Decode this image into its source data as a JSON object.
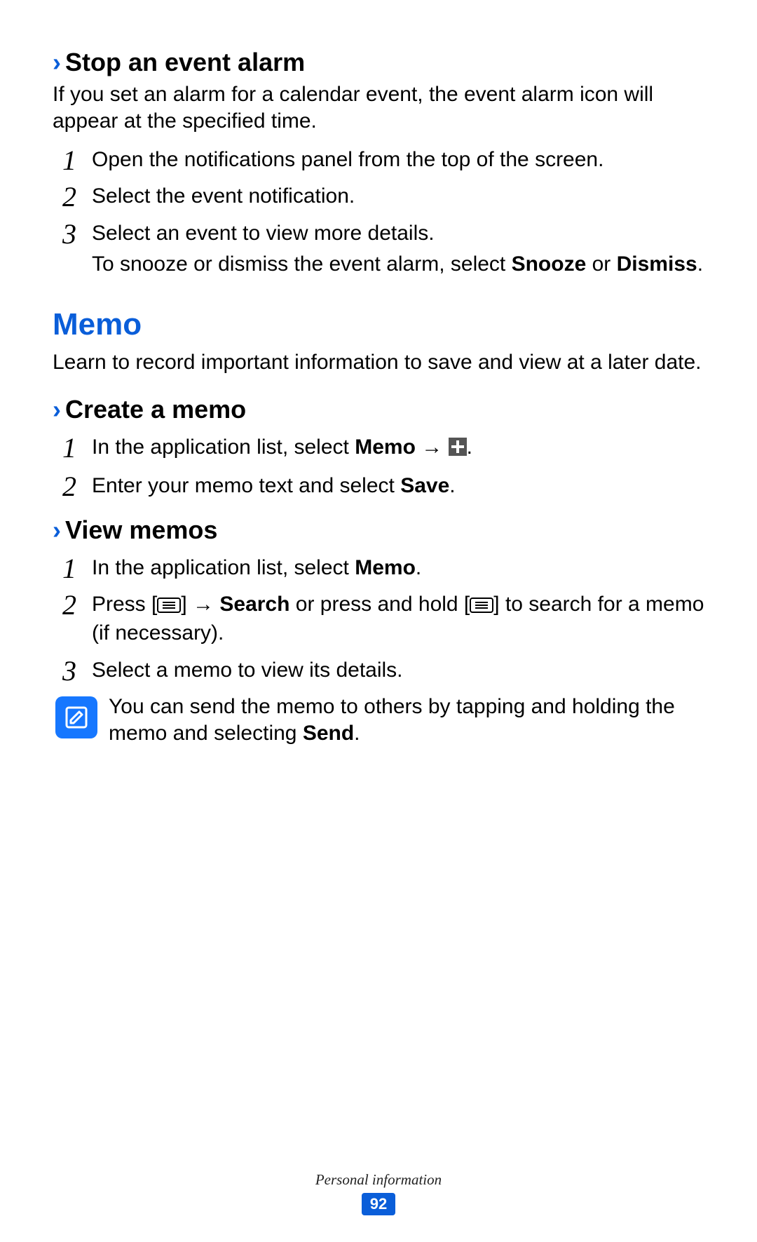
{
  "stop_alarm": {
    "heading": "Stop an event alarm",
    "intro": "If you set an alarm for a calendar event, the event alarm icon will appear at the specified time.",
    "steps": {
      "s1": "Open the notifications panel from the top of the screen.",
      "s2": "Select the event notification.",
      "s3a": "Select an event to view more details.",
      "s3b_pre": "To snooze or dismiss the event alarm, select ",
      "s3b_bold1": "Snooze",
      "s3b_mid": " or ",
      "s3b_bold2": "Dismiss",
      "s3b_post": "."
    }
  },
  "memo": {
    "title": "Memo",
    "intro": "Learn to record important information to save and view at a later date."
  },
  "create_memo": {
    "heading": "Create a memo",
    "s1_pre": "In the application list, select ",
    "s1_bold": "Memo",
    "s1_arrow": " → ",
    "s1_post": ".",
    "s2_pre": "Enter your memo text and select ",
    "s2_bold": "Save",
    "s2_post": "."
  },
  "view_memos": {
    "heading": "View memos",
    "s1_pre": "In the application list, select ",
    "s1_bold": "Memo",
    "s1_post": ".",
    "s2_pre": "Press [",
    "s2_arrow": "] → ",
    "s2_bold": "Search",
    "s2_mid": " or press and hold [",
    "s2_post": "] to search for a memo (if necessary).",
    "s3": "Select a memo to view its details.",
    "tip_pre": "You can send the memo to others by tapping and holding the memo and selecting ",
    "tip_bold": "Send",
    "tip_post": "."
  },
  "footer": {
    "section": "Personal information",
    "page": "92"
  }
}
